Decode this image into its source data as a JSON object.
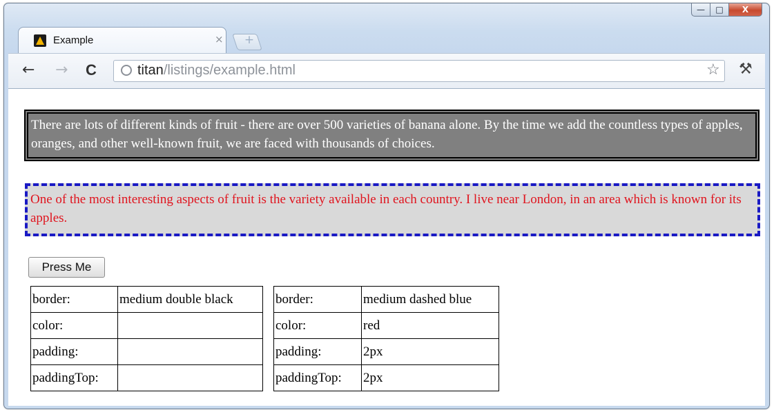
{
  "window": {
    "controls": {
      "minimize": "—",
      "maximize": "□",
      "close": "X"
    }
  },
  "tab": {
    "title": "Example",
    "close": "×",
    "newtab": "+"
  },
  "toolbar": {
    "back": "←",
    "forward": "→",
    "reload": "C",
    "url_host": "titan",
    "url_path": "/listings/example.html",
    "star": "☆",
    "wrench": "🔧"
  },
  "page": {
    "paragraph1": "There are lots of different kinds of fruit - there are over 500 varieties of banana alone. By the time we add the countless types of apples, oranges, and other well-known fruit, we are faced with thousands of choices.",
    "paragraph2": "One of the most interesting aspects of fruit is the variety available in each country. I live near London, in an area which is known for its apples.",
    "button": "Press Me",
    "table1": [
      {
        "key": "border:",
        "value": "medium double black"
      },
      {
        "key": "color:",
        "value": ""
      },
      {
        "key": "padding:",
        "value": ""
      },
      {
        "key": "paddingTop:",
        "value": ""
      }
    ],
    "table2": [
      {
        "key": "border:",
        "value": "medium dashed blue"
      },
      {
        "key": "color:",
        "value": "red"
      },
      {
        "key": "padding:",
        "value": "2px"
      },
      {
        "key": "paddingTop:",
        "value": "2px"
      }
    ]
  },
  "colors": {
    "p1_background": "#808080",
    "p1_text": "#ffffff",
    "p2_background": "#d9d9d9",
    "p2_text": "#e0141e",
    "p2_border": "#1a1ac4"
  }
}
